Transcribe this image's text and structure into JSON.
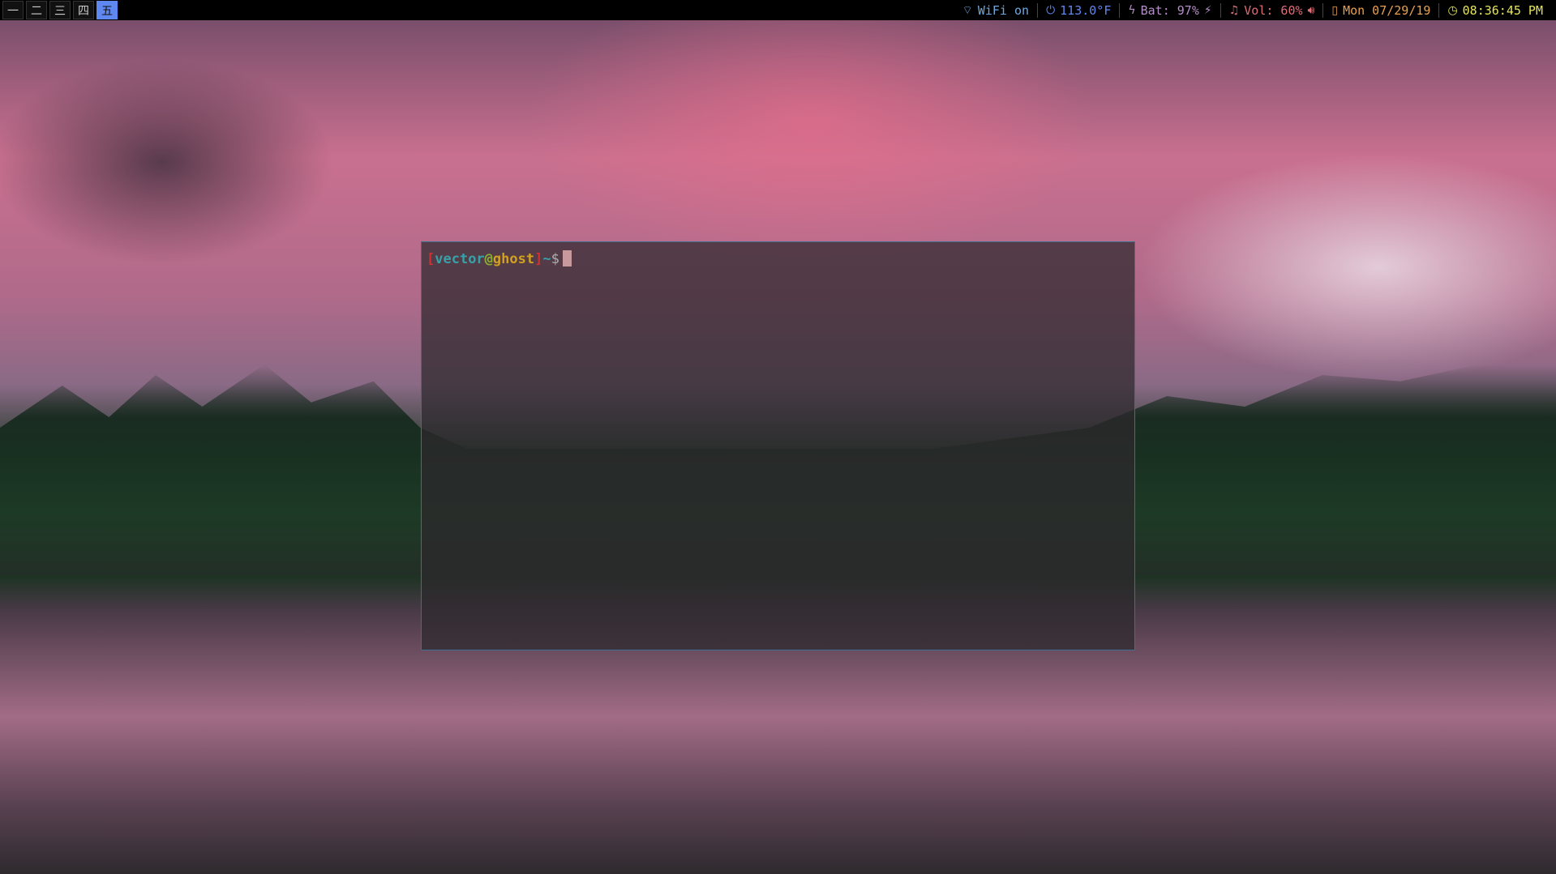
{
  "workspaces": [
    {
      "label": "一",
      "active": false
    },
    {
      "label": "二",
      "active": false
    },
    {
      "label": "三",
      "active": false
    },
    {
      "label": "四",
      "active": false
    },
    {
      "label": "五",
      "active": true
    }
  ],
  "status": {
    "wifi": {
      "icon": "wifi-icon",
      "text": "WiFi on",
      "color": "#6fa8dc"
    },
    "temp": {
      "icon": "power-icon",
      "text": "113.0°F",
      "color": "#5f87f0"
    },
    "battery": {
      "icon": "bolt-icon",
      "text": "Bat: 97%",
      "color": "#b48ec8",
      "plug_icon": "plug-icon"
    },
    "volume": {
      "icon": "music-note-icon",
      "text": "Vol: 60%",
      "color": "#e06c75",
      "speaker_icon": "speaker-icon"
    },
    "date": {
      "icon": "calendar-icon",
      "text": "Mon 07/29/19",
      "color": "#e8a050"
    },
    "time": {
      "icon": "clock-icon",
      "text": "08:36:45 PM",
      "color": "#e5e55a"
    }
  },
  "terminal": {
    "open_bracket": "[",
    "user": "vector",
    "at": "@",
    "host": "ghost",
    "close_bracket": "]",
    "path": "~",
    "prompt": "$"
  }
}
